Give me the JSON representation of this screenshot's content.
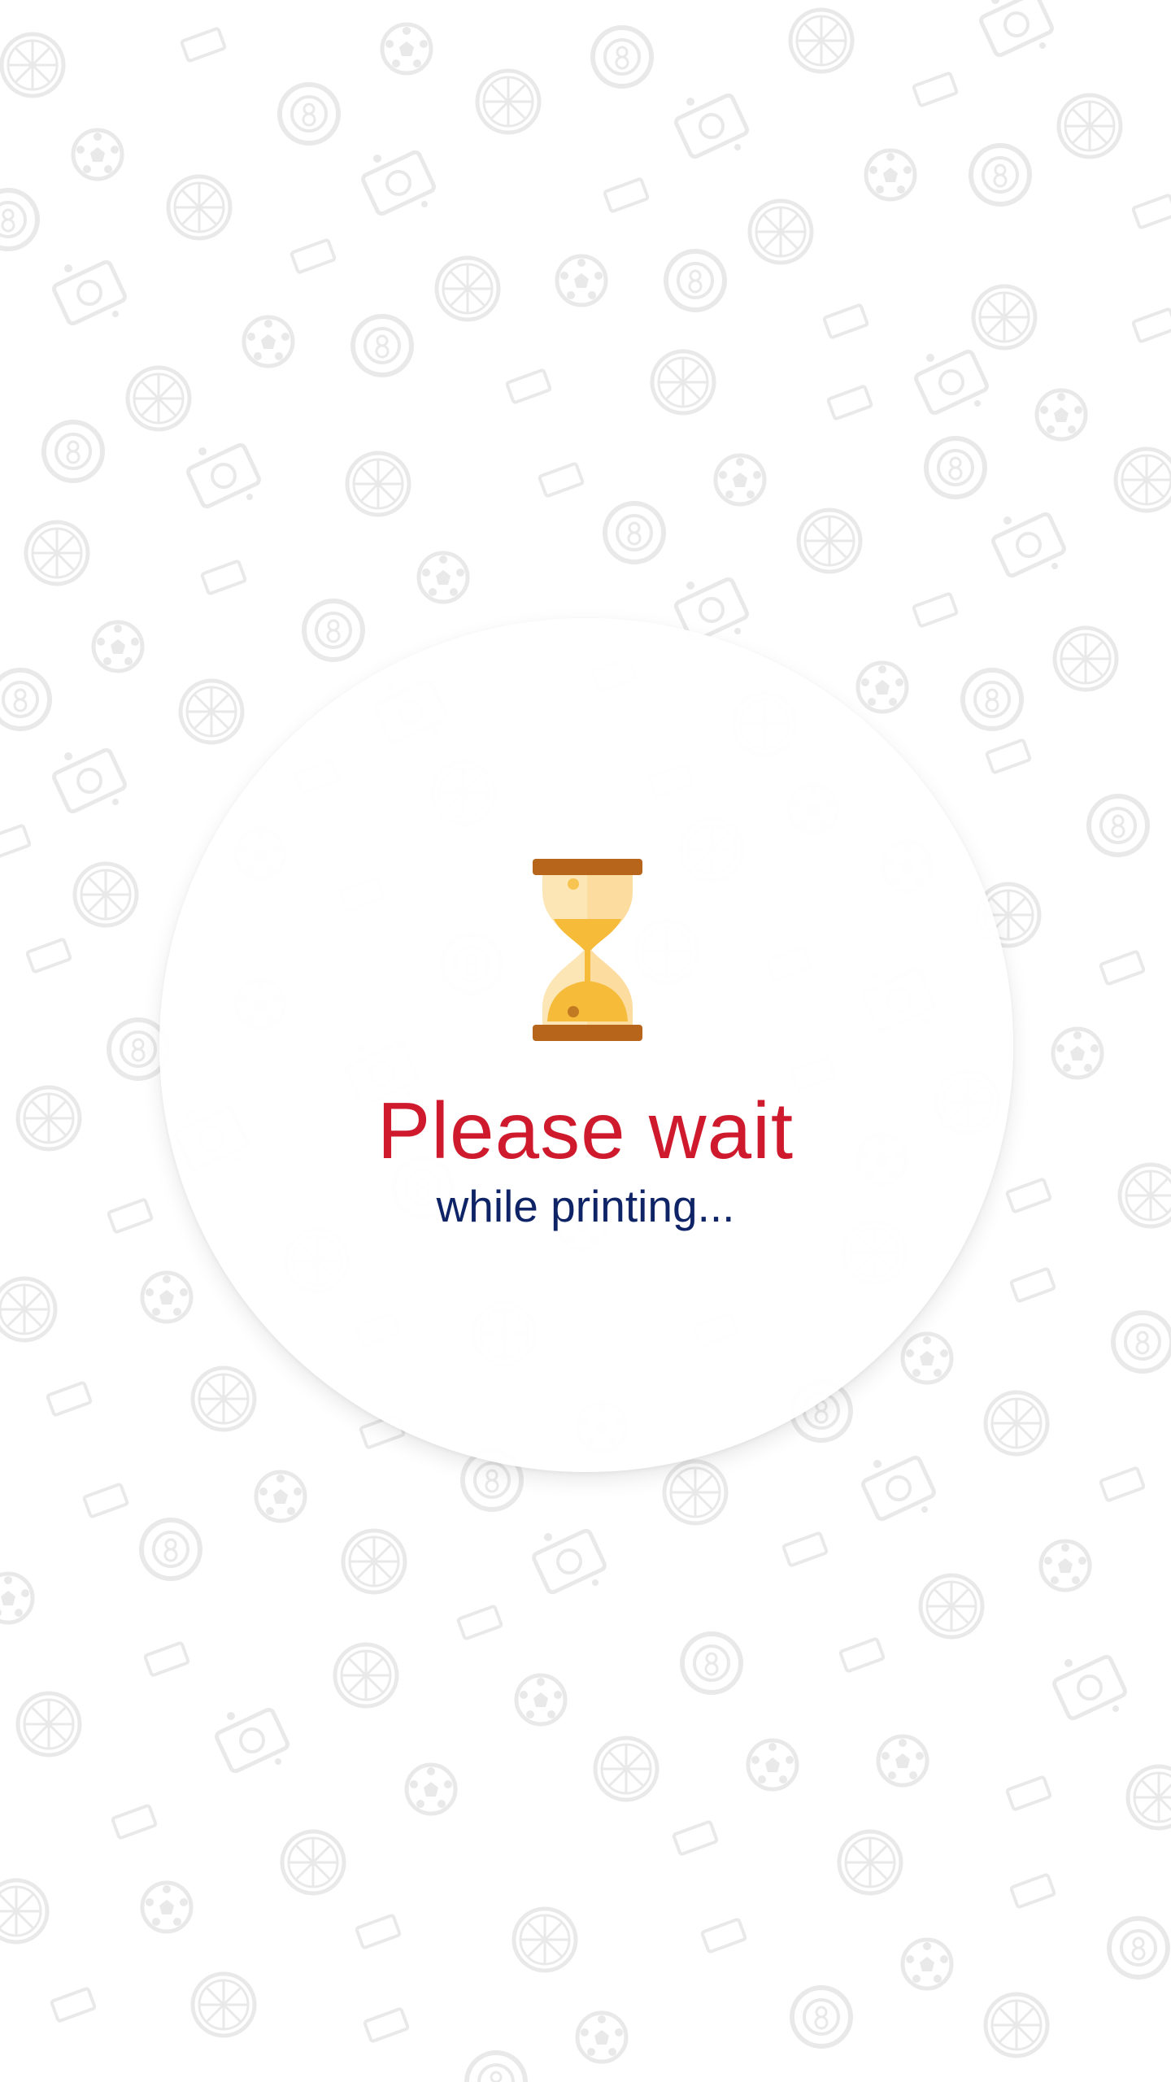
{
  "screen": {
    "status_title": "Please wait",
    "status_message": "while printing...",
    "icon": "hourglass-icon",
    "background_pattern_icons": [
      "pizza-icon",
      "soccer-ball-icon",
      "billiard-ball-icon",
      "ticket-icon",
      "camera-icon"
    ]
  },
  "colors": {
    "title": "#cf1a2e",
    "message": "#0f2466",
    "pattern": "#ebebeb",
    "hourglass_frame": "#b8651c",
    "hourglass_glass": "#fde6b6",
    "hourglass_sand": "#f5bb39"
  }
}
